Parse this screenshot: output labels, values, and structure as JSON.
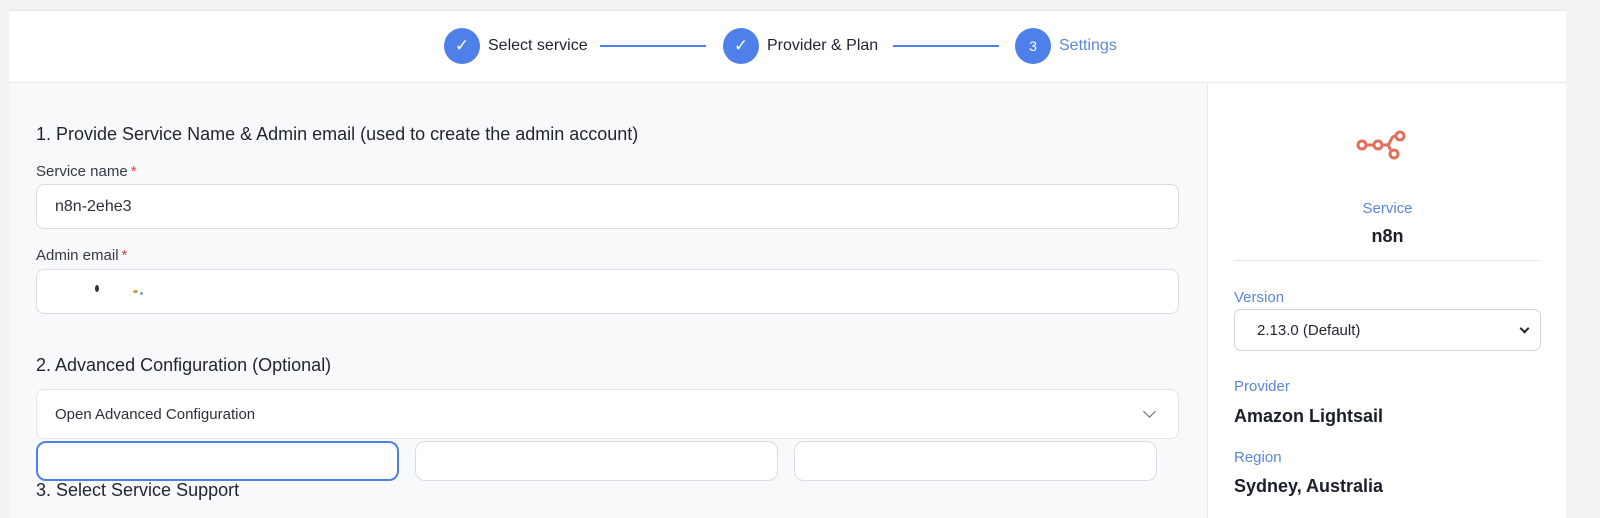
{
  "stepper": {
    "steps": [
      {
        "label": "Select service",
        "marker": "✓"
      },
      {
        "label": "Provider & Plan",
        "marker": "✓"
      },
      {
        "label": "Settings",
        "marker": "3"
      }
    ]
  },
  "section1": {
    "title": "1. Provide Service Name & Admin email (used to create the admin account)",
    "service_name_label": "Service name",
    "service_name_value": "n8n-2ehe3",
    "admin_email_label": "Admin email",
    "required_mark": "*"
  },
  "section2": {
    "title": "2. Advanced Configuration (Optional)",
    "accordion_label": "Open Advanced Configuration"
  },
  "section3": {
    "title": "3. Select Service Support"
  },
  "side": {
    "service_caption": "Service",
    "service_name": "n8n",
    "version_caption": "Version",
    "version_value": "2.13.0 (Default)",
    "provider_caption": "Provider",
    "provider_value": "Amazon Lightsail",
    "region_caption": "Region",
    "region_value": "Sydney, Australia"
  },
  "colors": {
    "accent": "#4f7fe8",
    "caption_blue": "#5b86d9",
    "logo": "#e0705a",
    "required": "#d64545"
  },
  "icons": {
    "step_done": "check-icon",
    "service_logo": "n8n-logo-icon",
    "accordion": "chevron-down-icon",
    "select": "chevron-down-icon"
  }
}
